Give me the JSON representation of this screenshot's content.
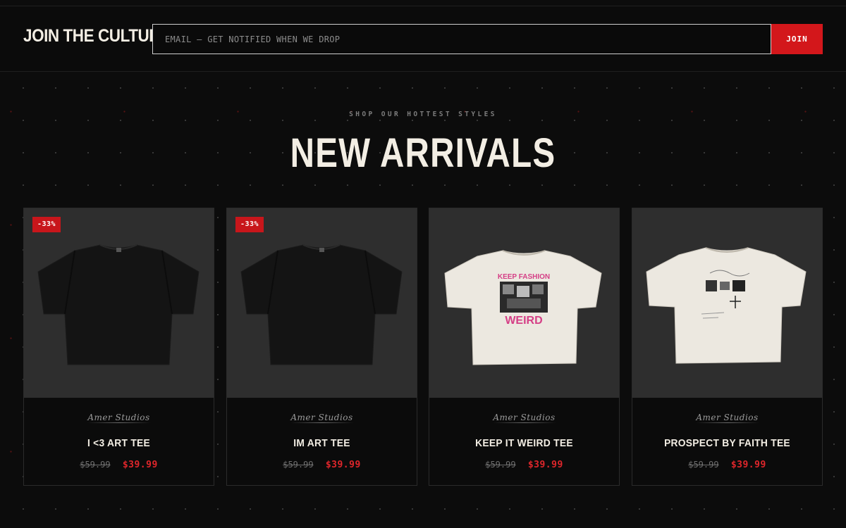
{
  "newsletter": {
    "title": "JOIN THE CULTURE",
    "input_placeholder": "EMAIL — GET NOTIFIED WHEN WE DROP",
    "button_label": "JOIN"
  },
  "section": {
    "eyebrow": "SHOP OUR HOTTEST STYLES",
    "title": "NEW ARRIVALS"
  },
  "colors": {
    "accent": "#d3171b",
    "background": "#0c0c0c",
    "card_image_bg": "#2e2e2e",
    "text": "#f3eee4"
  },
  "products": [
    {
      "name": "I <3 ART TEE",
      "brand": "Amer Studios",
      "badge": "-33%",
      "old_price": "$59.99",
      "price": "$39.99",
      "image": "black-tshirt"
    },
    {
      "name": "IM ART TEE",
      "brand": "Amer Studios",
      "badge": "-33%",
      "old_price": "$59.99",
      "price": "$39.99",
      "image": "black-tshirt"
    },
    {
      "name": "KEEP IT WEIRD TEE",
      "brand": "Amer Studios",
      "badge": "",
      "old_price": "$59.99",
      "price": "$39.99",
      "image": "white-tshirt-keep-fashion-weird",
      "graphic_text_top": "KEEP FASHION",
      "graphic_text_bottom": "WEIRD"
    },
    {
      "name": "PROSPECT BY FAITH TEE",
      "brand": "Amer Studios",
      "badge": "",
      "old_price": "$59.99",
      "price": "$39.99",
      "image": "white-tshirt-graphic"
    }
  ]
}
